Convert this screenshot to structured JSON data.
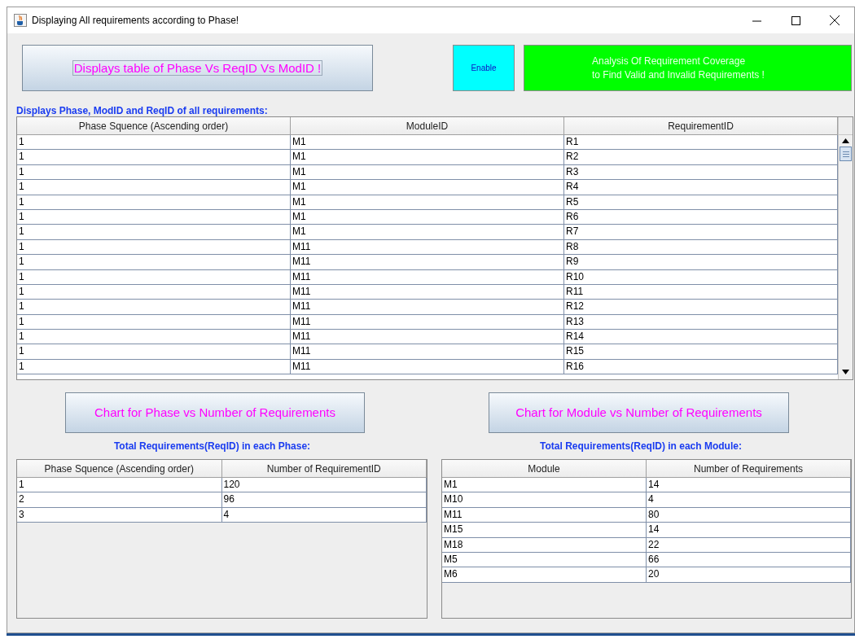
{
  "window": {
    "title": "Displaying All requirements according to Phase!"
  },
  "top_buttons": {
    "display_table": "Displays table of Phase Vs ReqID Vs ModID !",
    "enable": "Enable",
    "analysis": [
      "Analysis Of Requirement Coverage",
      "to Find Valid and Invalid Requirements !"
    ]
  },
  "main_table": {
    "caption": "Displays Phase, ModID and ReqID of all requirements:",
    "columns": [
      "Phase Squence (Ascending order)",
      "ModuleID",
      "RequirementID"
    ],
    "rows": [
      [
        "1",
        "M1",
        "R1"
      ],
      [
        "1",
        "M1",
        "R2"
      ],
      [
        "1",
        "M1",
        "R3"
      ],
      [
        "1",
        "M1",
        "R4"
      ],
      [
        "1",
        "M1",
        "R5"
      ],
      [
        "1",
        "M1",
        "R6"
      ],
      [
        "1",
        "M1",
        "R7"
      ],
      [
        "1",
        "M11",
        "R8"
      ],
      [
        "1",
        "M11",
        "R9"
      ],
      [
        "1",
        "M11",
        "R10"
      ],
      [
        "1",
        "M11",
        "R11"
      ],
      [
        "1",
        "M11",
        "R12"
      ],
      [
        "1",
        "M11",
        "R13"
      ],
      [
        "1",
        "M11",
        "R14"
      ],
      [
        "1",
        "M11",
        "R15"
      ],
      [
        "1",
        "M11",
        "R16"
      ]
    ]
  },
  "phase_panel": {
    "button": "Chart for Phase vs Number of Requirements",
    "caption": "Total Requirements(ReqID) in each Phase:",
    "columns": [
      "Phase Squence (Ascending order)",
      "Number of RequirementID"
    ],
    "rows": [
      [
        "1",
        "120"
      ],
      [
        "2",
        "96"
      ],
      [
        "3",
        "4"
      ]
    ]
  },
  "module_panel": {
    "button": "Chart for Module vs Number of Requirements",
    "caption": "Total Requirements(ReqID) in each Module:",
    "columns": [
      "Module",
      "Number of Requirements"
    ],
    "rows": [
      [
        "M1",
        "14"
      ],
      [
        "M10",
        "4"
      ],
      [
        "M11",
        "80"
      ],
      [
        "M15",
        "14"
      ],
      [
        "M18",
        "22"
      ],
      [
        "M5",
        "66"
      ],
      [
        "M6",
        "20"
      ]
    ]
  }
}
